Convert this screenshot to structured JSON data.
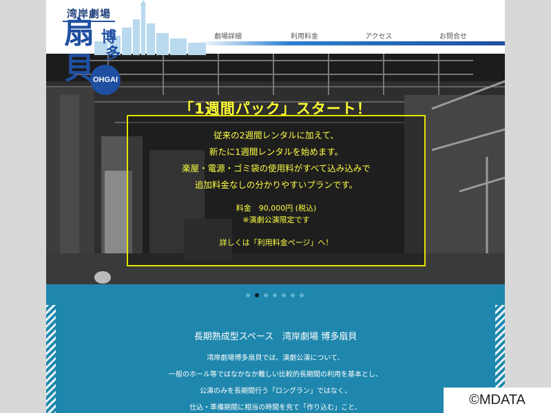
{
  "logo": {
    "title": "湾岸劇場",
    "big1": "扇",
    "big2": "貝",
    "small1": "博",
    "small2": "多",
    "badge": "OHGAI"
  },
  "nav": {
    "items": [
      {
        "label": "劇場詳細"
      },
      {
        "label": "利用料金"
      },
      {
        "label": "アクセス"
      },
      {
        "label": "お問合せ"
      }
    ]
  },
  "hero": {
    "heading": "「1週間パック」スタート！",
    "lines": [
      "従来の2週間レンタルに加えて、",
      "新たに1週間レンタルを始めます。",
      "楽屋・電源・ゴミ袋の使用料がすべて込み込みで",
      "追加料金なしの分かりやすいプランです。",
      "料金　90,000円 (税込)",
      "※演劇公演限定です",
      "詳しくは「利用料金ページ」へ！"
    ]
  },
  "slider": {
    "count": 7,
    "active_index": 1
  },
  "about": {
    "title": "長期熟成型スペース　湾岸劇場 博多扇貝",
    "lines": [
      "湾岸劇場博多扇貝では、演劇公演について、",
      "一般のホール等ではなかなか難しい比較的長期間の利用を基本とし、",
      "公演のみを長期間行う「ロングラン」ではなく、",
      "仕込・準備期間に相当の時間を充て「作り込む」こと、"
    ]
  },
  "watermark": "©MDATA",
  "colors": {
    "brand_blue": "#1f4fa0",
    "section_teal": "#1f87ad",
    "hero_text": "#ffff44"
  }
}
